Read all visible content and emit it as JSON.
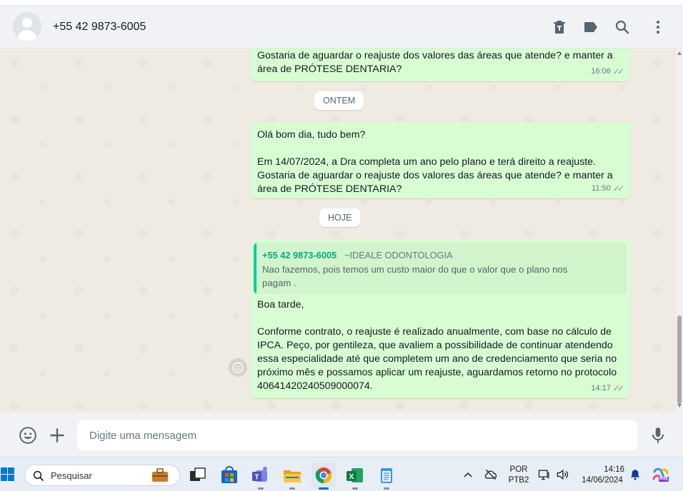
{
  "header": {
    "contact_name": "+55 42 9873-6005",
    "icons": [
      "delete-icon",
      "label-icon",
      "search-icon",
      "menu-icon"
    ]
  },
  "messages": [
    {
      "type": "out",
      "text": "Gostaria de aguardar o reajuste dos valores das áreas que atende? e manter a\nárea de PRÓTESE DENTARIA?",
      "time": "16:06",
      "status": "read"
    },
    {
      "type": "date",
      "label": "ONTEM"
    },
    {
      "type": "out",
      "text": "Olá bom dia, tudo bem?\n\nEm 14/07/2024, a Dra completa um ano pelo plano e terá direito a reajuste.\nGostaria de aguardar o reajuste dos valores das áreas que atende? e manter a\nárea de PRÓTESE DENTARIA?",
      "time": "11:50",
      "status": "read"
    },
    {
      "type": "date",
      "label": "HOJE"
    },
    {
      "type": "out",
      "quote": {
        "author": "+55 42 9873-6005",
        "alias": "~IDEALE ODONTOLOGIA",
        "text": "Nao fazemos, pois temos um custo maior do que o valor que o plano nos pagam ."
      },
      "text": "Boa tarde,\n\nConforme contrato, o reajuste é realizado anualmente, com base no cálculo de\nIPCA. Peço, por gentileza, que avaliem a possibilidade de continuar atendendo\nessa especialidade até que completem um ano de credenciamento que seria no\npróximo mês e possamos aplicar um reajuste, aguardamos retorno no protocolo\n40641420240509000074.",
      "time": "14:17",
      "status": "read"
    }
  ],
  "composer": {
    "placeholder": "Digite uma mensagem",
    "icons": [
      "emoji-icon",
      "attach-plus-icon",
      "microphone-icon"
    ]
  },
  "taskbar": {
    "search_label": "Pesquisar",
    "apps": [
      "work-briefcase-icon",
      "task-view-icon",
      "store-icon",
      "teams-icon",
      "file-explorer-icon",
      "chrome-icon",
      "excel-icon",
      "notepad-icon"
    ],
    "language": "POR",
    "keyboard": "PTB2",
    "time": "14:16",
    "date": "14/06/2024",
    "copilot_badge": "PRE"
  },
  "colors": {
    "outgoing_bubble": "#d9fdd3",
    "chat_background": "#efeae2",
    "quote_accent": "#06cf9c",
    "header_background": "#f0f2f5"
  }
}
